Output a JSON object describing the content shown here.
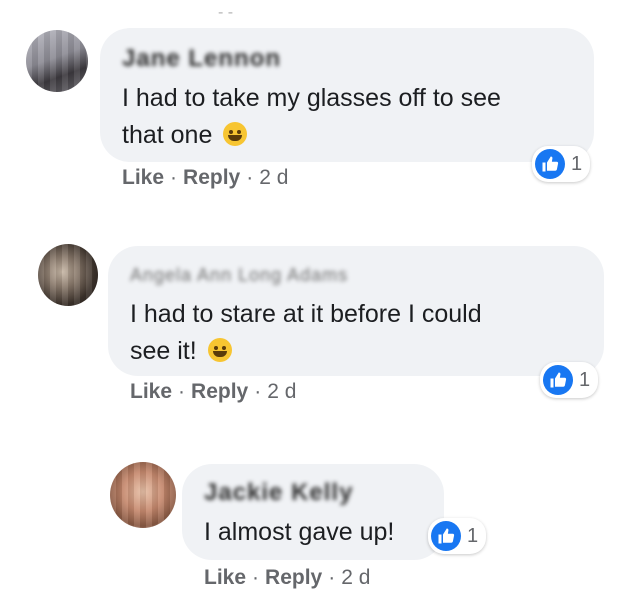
{
  "comments": [
    {
      "author": "Jane Lennon",
      "text_lines": [
        "I had to take my glasses off to see",
        "that one"
      ],
      "emoji": "smiling-face",
      "reactions": {
        "count": "1"
      },
      "actions": {
        "like": "Like",
        "reply": "Reply",
        "sep": "·",
        "time": "2 d"
      }
    },
    {
      "author": "Angela Ann Long Adams",
      "text_lines": [
        "I had to stare at it before I could",
        "see it!"
      ],
      "emoji": "tears-of-joy",
      "reactions": {
        "count": "1"
      },
      "actions": {
        "like": "Like",
        "reply": "Reply",
        "sep": "·",
        "time": "2 d"
      }
    },
    {
      "author": "Jackie Kelly",
      "text_lines": [
        "I almost gave up!"
      ],
      "reactions": {
        "count": "1"
      },
      "actions": {
        "like": "Like",
        "reply": "Reply",
        "sep": "·",
        "time": "2 d"
      }
    }
  ],
  "colors": {
    "bubble": "#f0f2f5",
    "like_blue": "#1877f2",
    "meta": "#65676b"
  }
}
